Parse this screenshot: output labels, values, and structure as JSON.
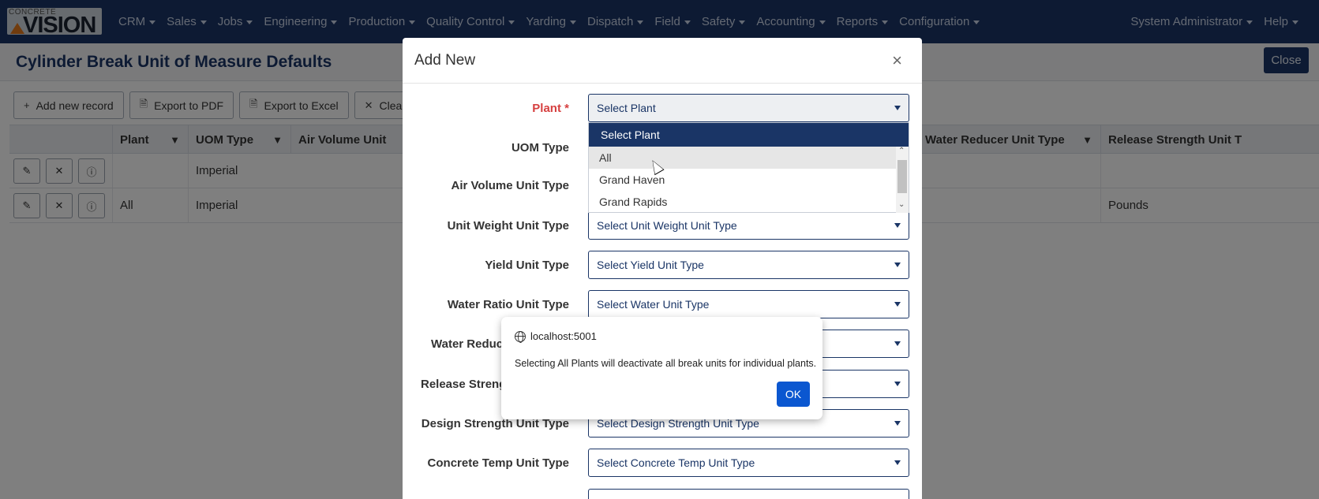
{
  "nav": {
    "logo_top": "CONCRETE",
    "logo_main": "VISION",
    "items": [
      "CRM",
      "Sales",
      "Jobs",
      "Engineering",
      "Production",
      "Quality Control",
      "Yarding",
      "Dispatch",
      "Field",
      "Safety",
      "Accounting",
      "Reports",
      "Configuration"
    ],
    "user": "System Administrator",
    "help": "Help"
  },
  "page": {
    "title": "Cylinder Break Unit of Measure Defaults",
    "close": "Close"
  },
  "toolbar": {
    "add": "Add new record",
    "pdf": "Export to PDF",
    "excel": "Export to Excel",
    "clear": "Clear"
  },
  "grid": {
    "columns": [
      "Plant",
      "UOM Type",
      "Air Volume Unit",
      "Water Reducer Unit Type",
      "Release Strength Unit T"
    ],
    "rows": [
      {
        "plant": "",
        "uom": "Imperial",
        "release": ""
      },
      {
        "plant": "All",
        "uom": "Imperial",
        "release": "Pounds"
      }
    ]
  },
  "modal": {
    "title": "Add New",
    "fields": [
      {
        "label": "Plant",
        "required": "*",
        "value": "Select Plant"
      },
      {
        "label": "UOM Type",
        "value": ""
      },
      {
        "label": "Air Volume Unit Type",
        "value": ""
      },
      {
        "label": "Unit Weight Unit Type",
        "value": "Select Unit Weight Unit Type"
      },
      {
        "label": "Yield Unit Type",
        "value": "Select Yield Unit Type"
      },
      {
        "label": "Water Ratio Unit Type",
        "value": "Select Water Unit Type"
      },
      {
        "label": "Water Reduc",
        "value": ""
      },
      {
        "label": "Release Strength",
        "value": ""
      },
      {
        "label": "Design Strength Unit Type",
        "value": "Select Design Strength Unit Type"
      },
      {
        "label": "Concrete Temp Unit Type",
        "value": "Select Concrete Temp Unit Type"
      }
    ],
    "dropdown_options": [
      "Select Plant",
      "All",
      "Grand Haven",
      "Grand Rapids"
    ]
  },
  "alert": {
    "origin": "localhost:5001",
    "message": "Selecting All Plants will deactivate all break units for individual plants.",
    "ok": "OK"
  }
}
